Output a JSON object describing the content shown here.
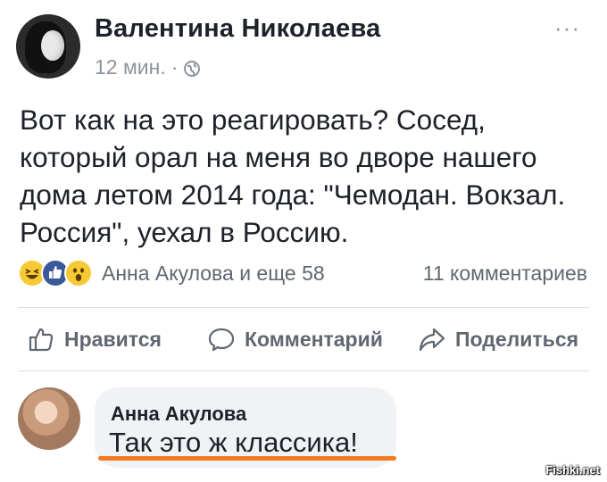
{
  "post": {
    "author": "Валентина Николаева",
    "time": "12 мин.",
    "separator": "·",
    "more_label": "···",
    "text": "Вот как на это реагировать? Сосед, который орал на меня во дворе нашего дома летом 2014 года: \"Чемодан. Вокзал. Россия\", уехал в Россию.",
    "icons": {
      "privacy": "globe-icon",
      "more": "more-options-icon"
    }
  },
  "reactions": {
    "types": [
      "haha",
      "like",
      "wow"
    ],
    "summary": "Анна Акулова и еще 58",
    "comments": "11 комментариев"
  },
  "actions": {
    "like": "Нравится",
    "comment": "Комментарий",
    "share": "Поделиться",
    "icons": [
      "thumbs-up-icon",
      "comment-bubble-icon",
      "share-arrow-icon"
    ]
  },
  "comment": {
    "author": "Анна Акулова",
    "text": "Так это ж классика!",
    "highlight_color": "#f47a21"
  },
  "watermark": "Fishki.net"
}
